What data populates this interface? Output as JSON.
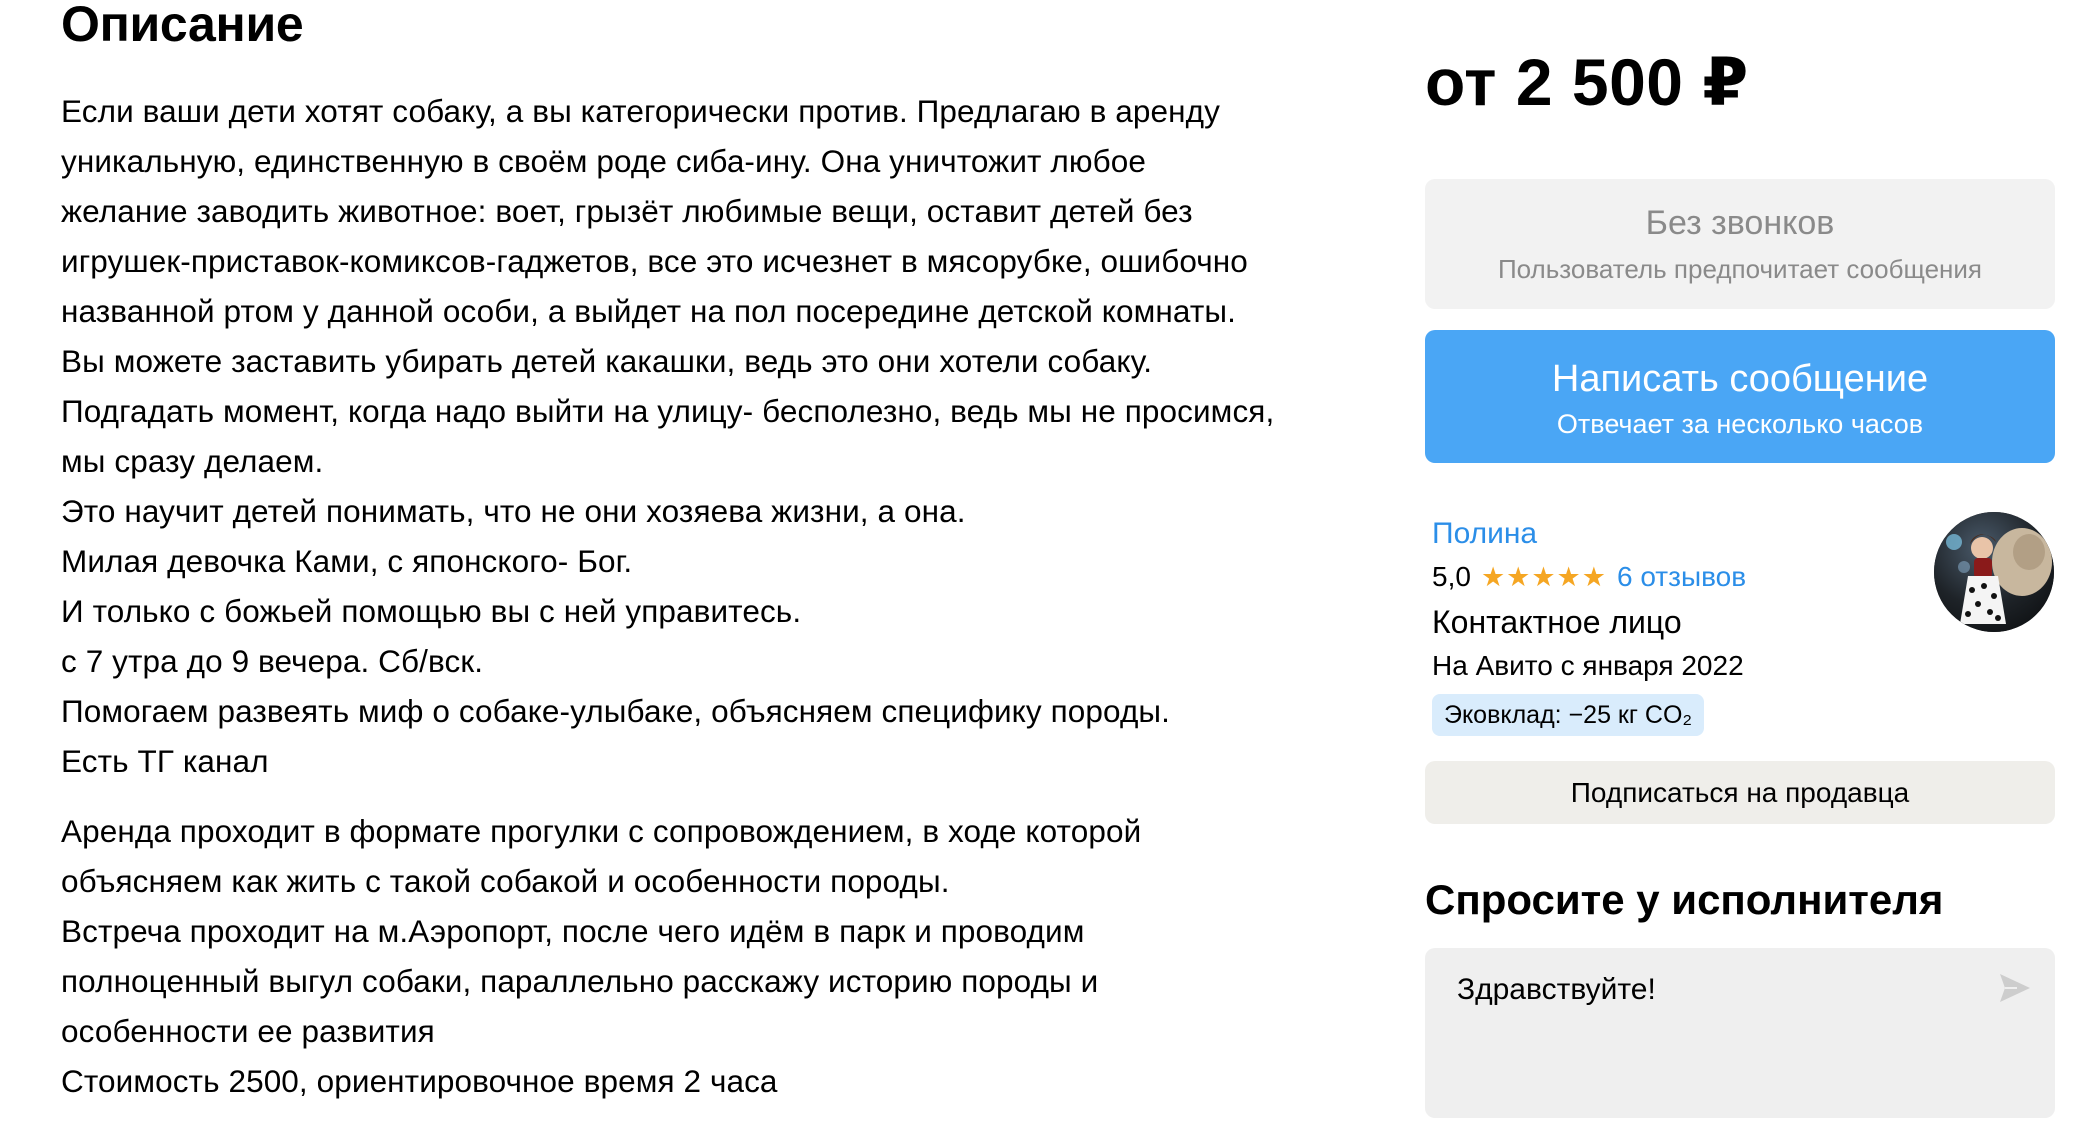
{
  "description": {
    "title": "Описание",
    "paragraph1": [
      "Если ваши дети хотят собаку, а вы категорически против. Предлагаю в аренду",
      "уникальную, единственную в своём роде сиба-ину. Она уничтожит любое",
      "желание заводить животное: воет, грызёт любимые вещи, оставит детей без",
      "игрушек-приставок-комиксов-гаджетов, все это исчезнет в мясорубке, ошибочно",
      "названной ртом у данной особи, а выйдет на пол посередине детской комнаты.",
      "Вы можете заставить убирать детей какашки, ведь это они хотели собаку.",
      "Подгадать момент, когда надо выйти на улицу- бесполезно, ведь мы не просимся,",
      "мы сразу делаем.",
      "Это научит детей понимать, что не они хозяева жизни, а она.",
      "Милая девочка Ками, с японского- Бог.",
      "И только с божьей помощью вы с ней управитесь.",
      "с 7 утра до 9 вечера. Сб/вск.",
      "Помогаем развеять миф о собаке-улыбаке, объясняем специфику породы.",
      "Есть ТГ канал"
    ],
    "paragraph2": [
      "Аренда проходит в формате прогулки с сопровождением, в ходе которой",
      "объясняем как жить с такой собакой и особенности породы.",
      "Встреча проходит на м.Аэропорт, после чего идём в парк и проводим",
      "полноценный выгул собаки, параллельно расскажу историю породы и",
      "особенности ее развития",
      "Стоимость 2500, ориентировочное время 2 часа"
    ]
  },
  "sidebar": {
    "price": "от 2 500 ₽",
    "no_calls": {
      "title": "Без звонков",
      "subtitle": "Пользователь предпочитает сообщения"
    },
    "write_button": {
      "title": "Написать сообщение",
      "subtitle": "Отвечает за несколько часов"
    },
    "seller": {
      "name": "Полина",
      "rating": "5,0",
      "stars": "★★★★★",
      "stars_count": 5,
      "reviews": "6 отзывов",
      "role": "Контактное лицо",
      "since": "На Авито с января 2022",
      "eco_badge": "Эковклад: −25 кг CO₂"
    },
    "subscribe_button": "Подписаться на продавца",
    "ask": {
      "title": "Спросите у исполнителя",
      "input_value": "Здравствуйте!",
      "send_icon": "send-arrow-icon"
    }
  },
  "colors": {
    "accent_blue": "#4aa6f5",
    "link_blue": "#2b8ee8",
    "star_orange": "#f5a623",
    "badge_bg": "#d9ecfc",
    "muted_text": "#8a8a8a"
  }
}
